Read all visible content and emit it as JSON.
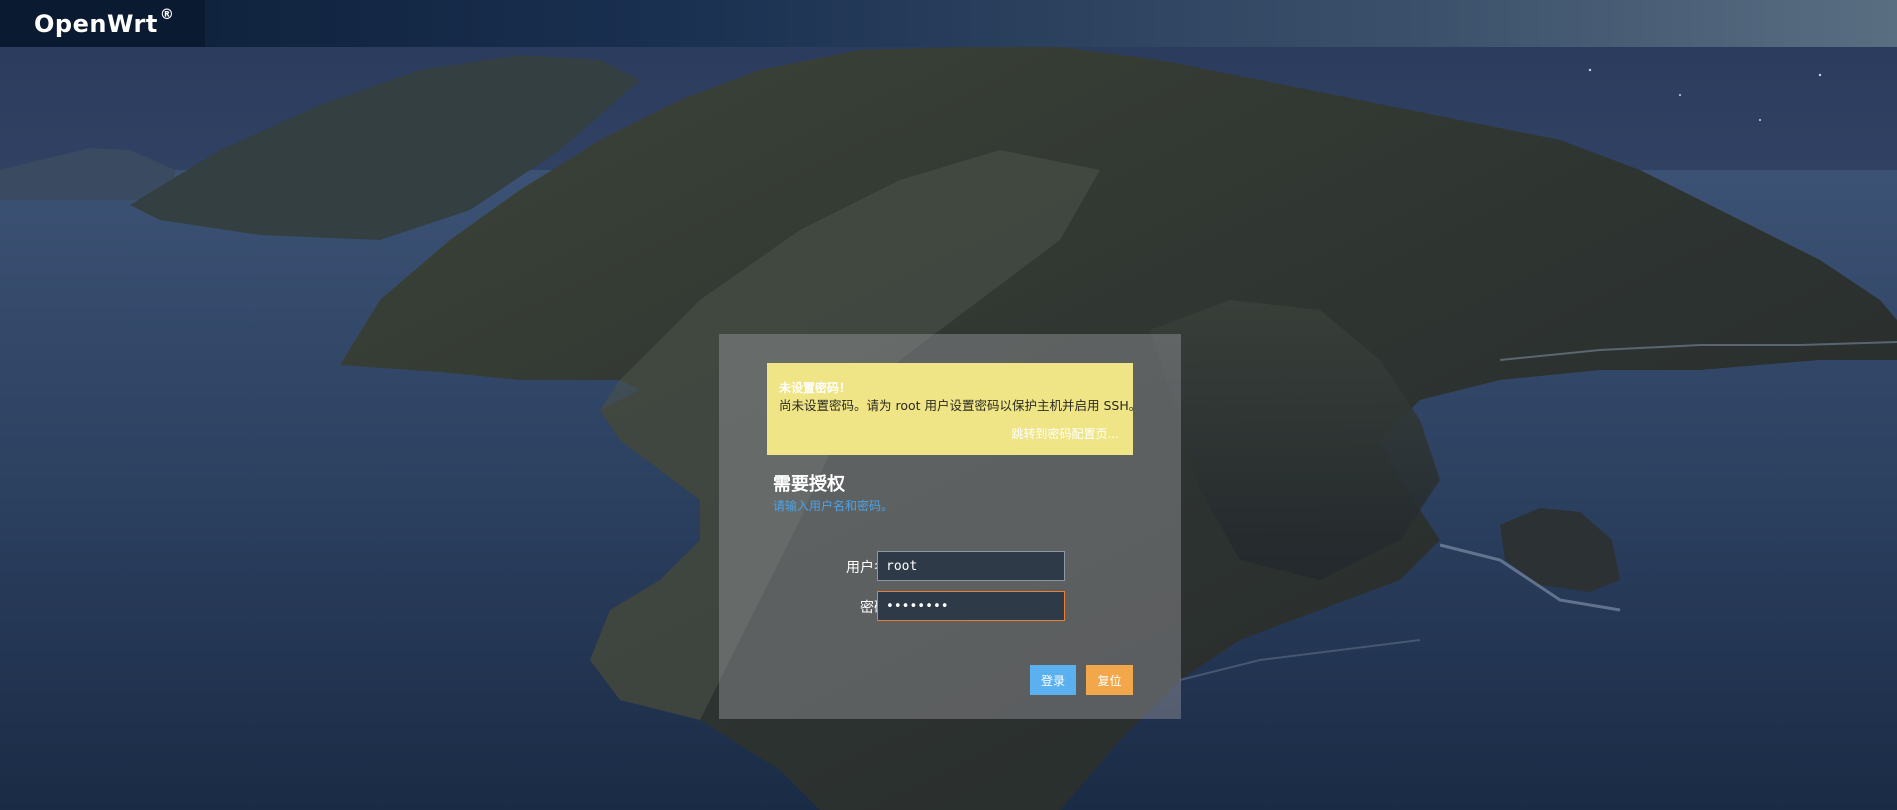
{
  "header": {
    "brand": "OpenWrt",
    "brand_mark": "®"
  },
  "alert": {
    "title": "未设置密码！",
    "message": "尚未设置密码。请为 root 用户设置密码以保护主机并启用 SSH。",
    "link": "跳转到密码配置页..."
  },
  "auth": {
    "title": "需要授权",
    "subtitle": "请输入用户名和密码。"
  },
  "form": {
    "username_label": "用户名",
    "username_value": "root",
    "password_label": "密码",
    "password_value": "password"
  },
  "buttons": {
    "login": "登录",
    "reset": "复位"
  },
  "colors": {
    "alert_bg": "#efe486",
    "login_button": "#5bb0f0",
    "reset_button": "#f2a84a",
    "focus_border": "#e8803a",
    "subtitle": "#4da3e8"
  }
}
